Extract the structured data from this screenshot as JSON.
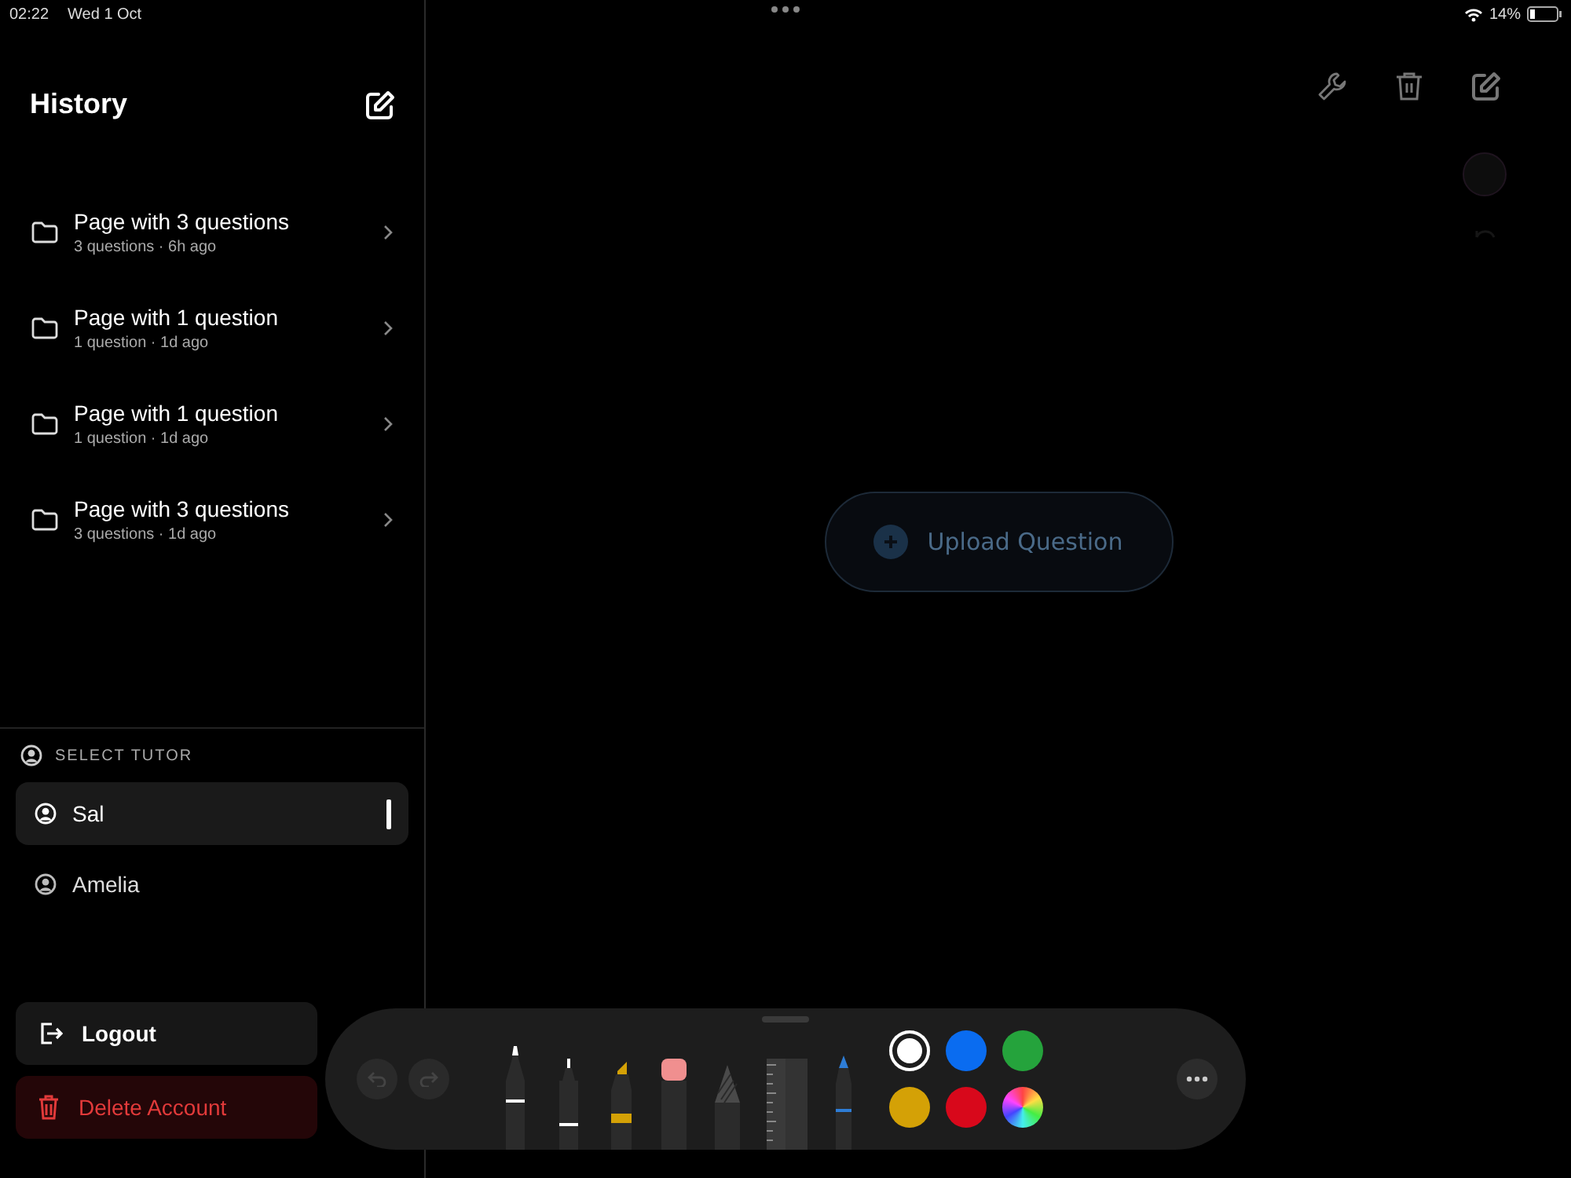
{
  "status_bar": {
    "time": "02:22",
    "date": "Wed 1 Oct",
    "battery": "14%"
  },
  "sidebar": {
    "title": "History",
    "history": [
      {
        "title": "Page with 3 questions",
        "subtitle": "3 questions · 6h ago"
      },
      {
        "title": "Page with 1 question",
        "subtitle": "1 question · 1d ago"
      },
      {
        "title": "Page with 1 question",
        "subtitle": "1 question · 1d ago"
      },
      {
        "title": "Page with 3 questions",
        "subtitle": "3 questions · 1d ago"
      }
    ],
    "tutor_label": "SELECT TUTOR",
    "tutors": [
      {
        "name": "Sal",
        "selected": true
      },
      {
        "name": "Amelia",
        "selected": false
      }
    ],
    "actions": [
      {
        "kind": "logout",
        "label": "Logout"
      },
      {
        "kind": "delete",
        "label": "Delete Account"
      }
    ]
  },
  "main": {
    "upload_button": "Upload Question"
  },
  "palette": {
    "tools": [
      {
        "kind": "pen"
      },
      {
        "kind": "fineliner"
      },
      {
        "kind": "marker"
      },
      {
        "kind": "eraser"
      },
      {
        "kind": "pencil"
      },
      {
        "kind": "ruler"
      },
      {
        "kind": "brush"
      }
    ],
    "colors": [
      {
        "kind": "swatch",
        "color": "#ffffff",
        "selected": true
      },
      {
        "kind": "swatch",
        "color": "#0a6cf0",
        "selected": false
      },
      {
        "kind": "swatch",
        "color": "#25a33c",
        "selected": false
      },
      {
        "kind": "swatch",
        "color": "#d4a106",
        "selected": false
      },
      {
        "kind": "swatch",
        "color": "#d8081b",
        "selected": false
      },
      {
        "kind": "wheel",
        "selected": false
      }
    ]
  }
}
